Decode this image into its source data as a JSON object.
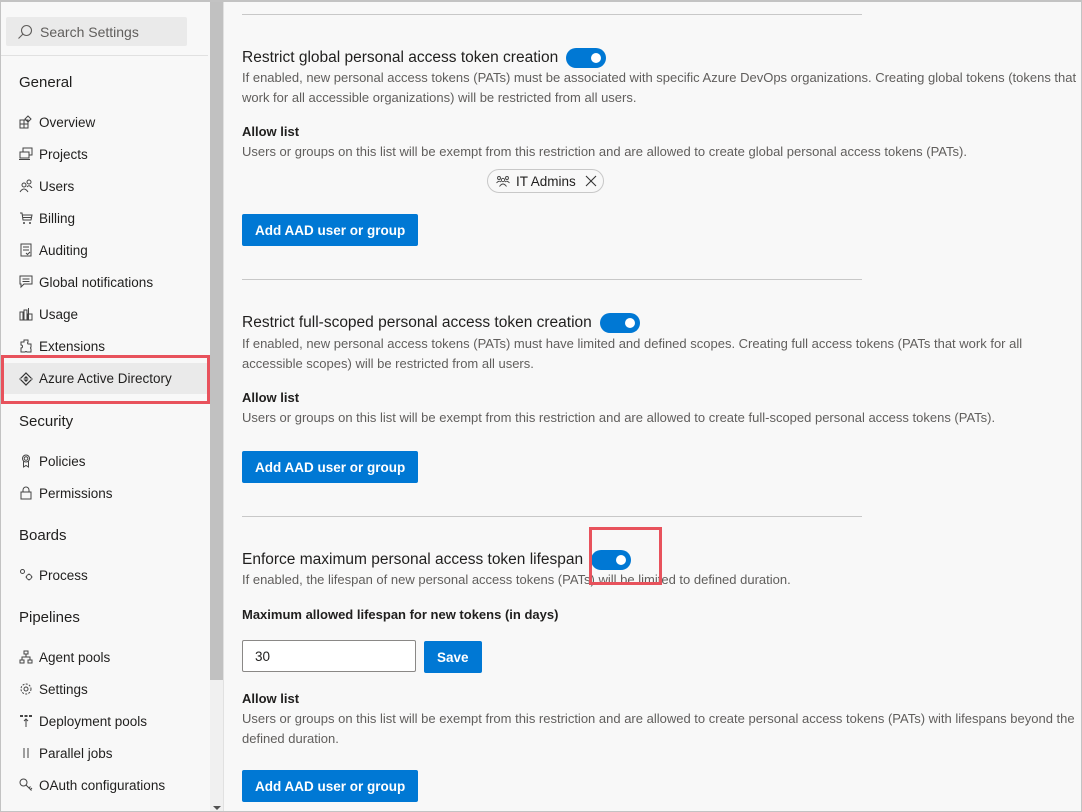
{
  "sidebar": {
    "search_placeholder": "Search Settings",
    "groups": [
      {
        "title": "General",
        "items": [
          {
            "label": "Overview",
            "icon": "overview-icon"
          },
          {
            "label": "Projects",
            "icon": "projects-icon"
          },
          {
            "label": "Users",
            "icon": "users-icon"
          },
          {
            "label": "Billing",
            "icon": "cart-icon"
          },
          {
            "label": "Auditing",
            "icon": "auditing-icon"
          },
          {
            "label": "Global notifications",
            "icon": "chat-icon"
          },
          {
            "label": "Usage",
            "icon": "usage-icon"
          },
          {
            "label": "Extensions",
            "icon": "extensions-icon"
          },
          {
            "label": "Azure Active Directory",
            "icon": "aad-icon",
            "selected": true
          }
        ]
      },
      {
        "title": "Security",
        "items": [
          {
            "label": "Policies",
            "icon": "badge-icon"
          },
          {
            "label": "Permissions",
            "icon": "lock-icon"
          }
        ]
      },
      {
        "title": "Boards",
        "items": [
          {
            "label": "Process",
            "icon": "process-icon"
          }
        ]
      },
      {
        "title": "Pipelines",
        "items": [
          {
            "label": "Agent pools",
            "icon": "agent-pools-icon"
          },
          {
            "label": "Settings",
            "icon": "gear-icon"
          },
          {
            "label": "Deployment pools",
            "icon": "deployment-pools-icon"
          },
          {
            "label": "Parallel jobs",
            "icon": "parallel-jobs-icon"
          },
          {
            "label": "OAuth configurations",
            "icon": "key-icon"
          }
        ]
      }
    ]
  },
  "sections": [
    {
      "title": "Restrict global personal access token creation",
      "enabled": true,
      "description": "If enabled, new personal access tokens (PATs) must be associated with specific Azure DevOps organizations. Creating global tokens (tokens that work for all accessible organizations) will be restricted from all users.",
      "allow_list_label": "Allow list",
      "allow_list_description": "Users or groups on this list will be exempt from this restriction and are allowed to create global personal access tokens (PATs).",
      "allow_list_entries": [
        "IT Admins"
      ],
      "add_button": "Add AAD user or group"
    },
    {
      "title": "Restrict full-scoped personal access token creation",
      "enabled": true,
      "description": "If enabled, new personal access tokens (PATs) must have limited and defined scopes. Creating full access tokens (PATs that work for all accessible scopes) will be restricted from all users.",
      "allow_list_label": "Allow list",
      "allow_list_description": "Users or groups on this list will be exempt from this restriction and are allowed to create full-scoped personal access tokens (PATs).",
      "add_button": "Add AAD user or group"
    },
    {
      "title": "Enforce maximum personal access token lifespan",
      "enabled": true,
      "description": "If enabled, the lifespan of new personal access tokens (PATs) will be limited to defined duration.",
      "lifespan_label": "Maximum allowed lifespan for new tokens (in days)",
      "lifespan_value": "30",
      "save_button": "Save",
      "allow_list_label": "Allow list",
      "allow_list_description": "Users or groups on this list will be exempt from this restriction and are allowed to create personal access tokens (PATs) with lifespans beyond the defined duration.",
      "add_button": "Add AAD user or group"
    }
  ],
  "colors": {
    "accent": "#0078d4",
    "highlight": "#e8525c"
  }
}
